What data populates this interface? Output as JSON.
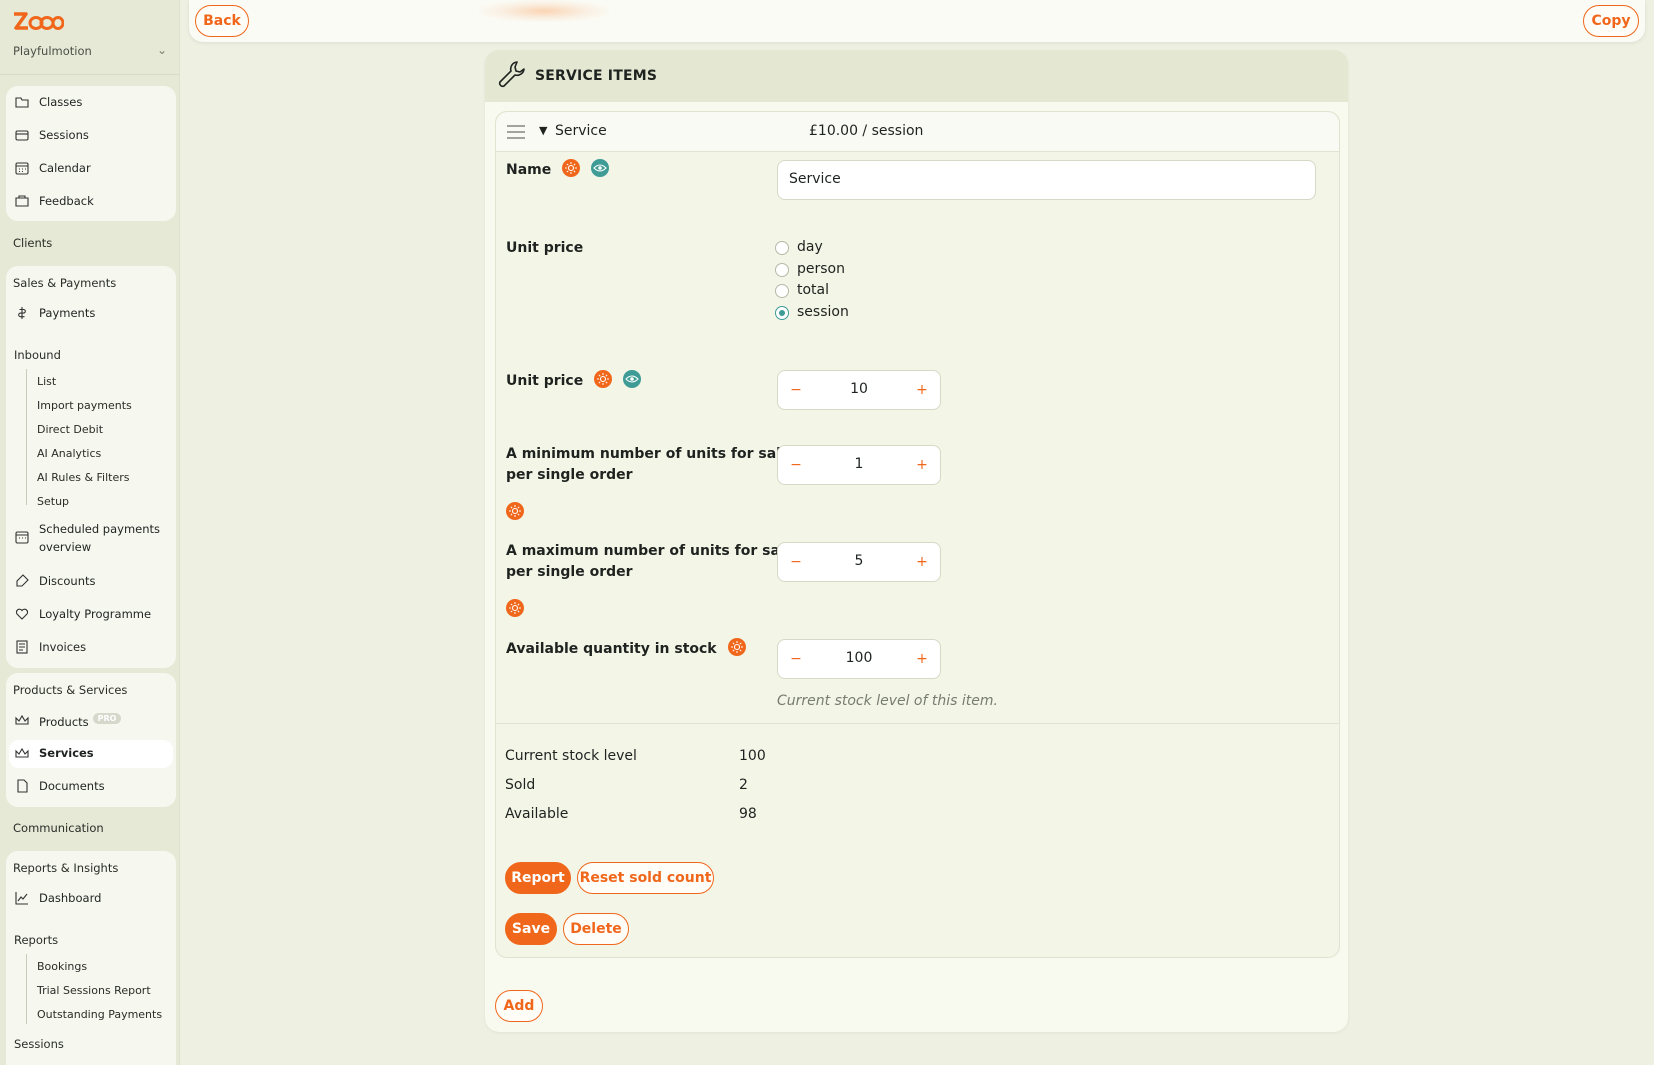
{
  "sidebar": {
    "org_name": "Playfulmotion",
    "group1": [
      {
        "label": "Classes",
        "icon": "folder-icon"
      },
      {
        "label": "Sessions",
        "icon": "sessions-icon"
      },
      {
        "label": "Calendar",
        "icon": "calendar-icon"
      },
      {
        "label": "Feedback",
        "icon": "feedback-icon"
      }
    ],
    "clients": "Clients",
    "sales_heading": "Sales & Payments",
    "payments": "Payments",
    "inbound": "Inbound",
    "inbound_items": [
      "List",
      "Import payments",
      "Direct Debit",
      "AI Analytics",
      "AI Rules & Filters",
      "Setup"
    ],
    "scheduled_line1": "Scheduled payments",
    "scheduled_line2": "overview",
    "discounts": "Discounts",
    "loyalty": "Loyalty Programme",
    "invoices": "Invoices",
    "products_heading": "Products & Services",
    "products": "Products",
    "pro_badge": "PRO",
    "services": "Services",
    "documents": "Documents",
    "communication": "Communication",
    "reports_heading": "Reports & Insights",
    "dashboard": "Dashboard",
    "reports": "Reports",
    "report_items": [
      "Bookings",
      "Trial Sessions Report",
      "Outstanding Payments"
    ],
    "sessions_bottom": "Sessions"
  },
  "topbar": {
    "back_label": "Back",
    "copy_label": "Copy"
  },
  "panel": {
    "title": "SERVICE ITEMS",
    "item": {
      "name": "Service",
      "price_summary": "£10.00 / session"
    },
    "fields": {
      "name_label": "Name",
      "name_value": "Service",
      "unit_price_label": "Unit price",
      "unit_options": [
        {
          "label": "day",
          "checked": false
        },
        {
          "label": "person",
          "checked": false
        },
        {
          "label": "total",
          "checked": false
        },
        {
          "label": "session",
          "checked": true
        }
      ],
      "unit_price_value_label": "Unit price",
      "unit_price_value": "10",
      "min_label_line1": "A minimum number of units for sale",
      "min_label_line2": "per single order",
      "min_value": "1",
      "max_label_line1": "A maximum number of units for sale",
      "max_label_line2": "per single order",
      "max_value": "5",
      "stock_label": "Available quantity in stock",
      "stock_value": "100",
      "stock_hint": "Current stock level of this item.",
      "minus": "−",
      "plus": "+"
    },
    "stats": [
      {
        "label": "Current stock level",
        "value": "100"
      },
      {
        "label": "Sold",
        "value": "2"
      },
      {
        "label": "Available",
        "value": "98"
      }
    ],
    "buttons": {
      "report": "Report",
      "reset": "Reset sold count",
      "save": "Save",
      "delete": "Delete",
      "add": "Add"
    }
  },
  "colors": {
    "accent": "#f0671b",
    "teal": "#3f9b95",
    "background": "#eef0e2"
  }
}
